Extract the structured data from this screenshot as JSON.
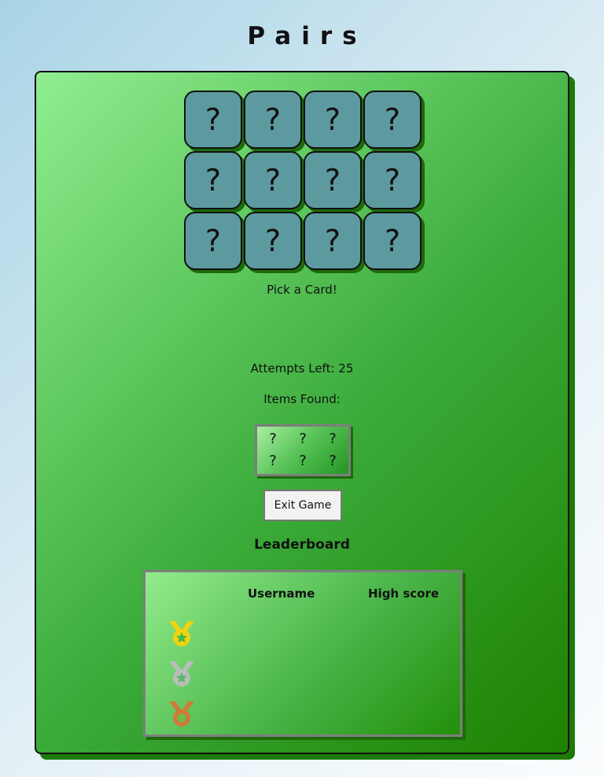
{
  "title": "Pairs",
  "cards": [
    "?",
    "?",
    "?",
    "?",
    "?",
    "?",
    "?",
    "?",
    "?",
    "?",
    "?",
    "?"
  ],
  "status": "Pick a Card!",
  "attempts": "Attempts Left: 25",
  "items_found_label": "Items Found:",
  "found_slots": [
    "?",
    "?",
    "?",
    "?",
    "?",
    "?"
  ],
  "exit_label": "Exit Game",
  "leaderboard": {
    "title": "Leaderboard",
    "col_username": "Username",
    "col_score": "High score",
    "medals": [
      {
        "icon": "gold-medal-icon",
        "color": "#f1d30e"
      },
      {
        "icon": "silver-medal-icon",
        "color": "#b9bdb8"
      },
      {
        "icon": "bronze-medal-icon",
        "color": "#d07a3a"
      }
    ]
  },
  "colors": {
    "card": "#5d9aa0",
    "board_light": "#90ee90",
    "board_dark": "#1e8100",
    "medal_star_gold": "#40b84a",
    "medal_star_silver": "#5ab86a"
  }
}
